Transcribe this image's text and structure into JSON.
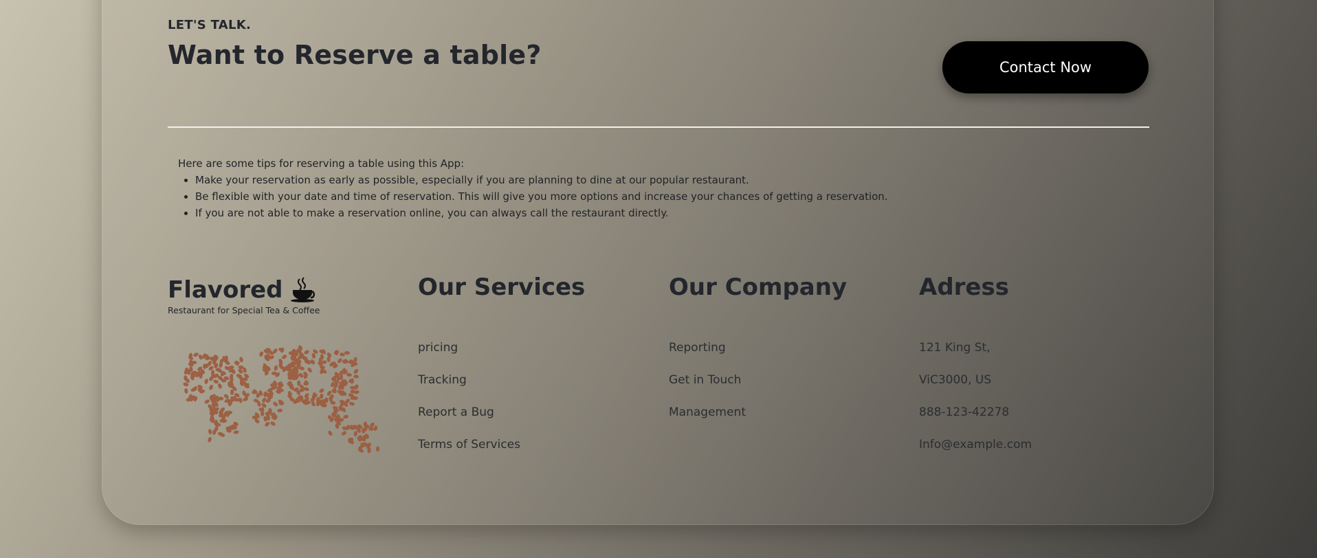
{
  "reserve": {
    "eyebrow": "LET'S TALK.",
    "headline": "Want to Reserve a table?",
    "cta_label": "Contact Now"
  },
  "tips": {
    "intro": "Here are some tips for reserving a table using this App:",
    "items": [
      "Make your reservation as early as possible, especially if you are planning to dine at our popular restaurant.",
      "Be flexible with your date and time of reservation. This will give you more options and increase your chances of getting a reservation.",
      "If you are not able to make a reservation online, you can always call the restaurant directly."
    ]
  },
  "footer": {
    "brand": {
      "name": "Flavored",
      "tagline": "Restaurant for Special Tea & Coffee",
      "icon": "coffee-cup-icon"
    },
    "services": {
      "title": "Our Services",
      "links": [
        "pricing",
        "Tracking",
        "Report a Bug",
        "Terms of Services"
      ]
    },
    "company": {
      "title": "Our Company",
      "links": [
        "Reporting",
        "Get in Touch",
        "Management"
      ]
    },
    "address": {
      "title": "Adress",
      "lines": [
        "121 King St,",
        "ViC3000, US",
        "888-123-42278",
        "Info@example.com"
      ]
    }
  },
  "colors": {
    "cta_bg": "#000000",
    "text": "#23262c",
    "divider": "#f4f1ea",
    "bean": "#9c5a3c"
  }
}
